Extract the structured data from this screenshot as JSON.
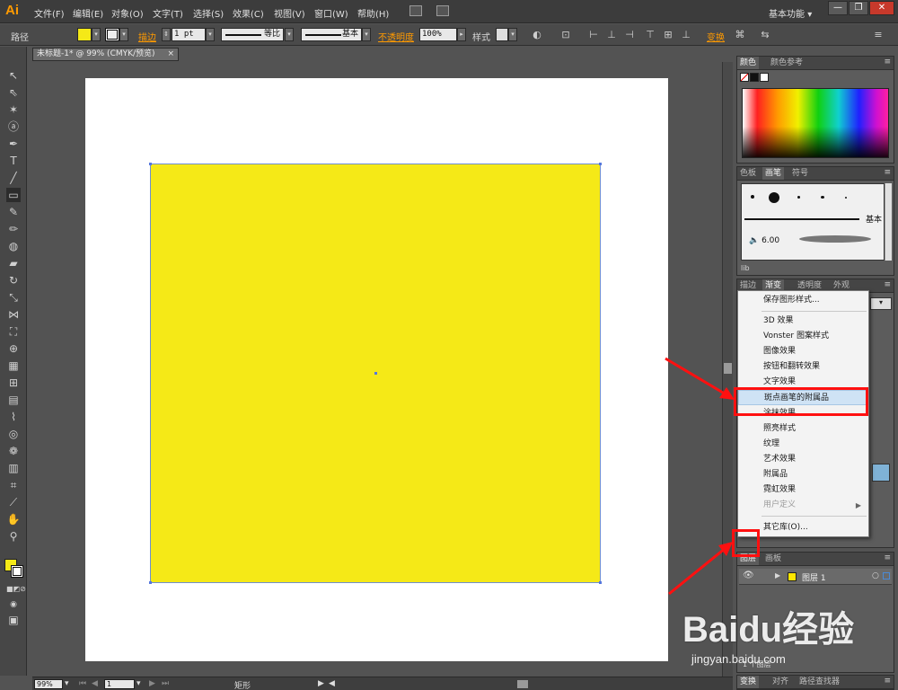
{
  "app": {
    "logo": "Ai",
    "workspace": "基本功能",
    "workspace_arrow": "▾"
  },
  "menu": [
    "文件(F)",
    "编辑(E)",
    "对象(O)",
    "文字(T)",
    "选择(S)",
    "效果(C)",
    "视图(V)",
    "窗口(W)",
    "帮助(H)"
  ],
  "window_buttons": {
    "minimize": "—",
    "restore": "❐",
    "close": "✕"
  },
  "control": {
    "object_type": "路径",
    "stroke_label": "描边",
    "stroke_weight": "1 pt",
    "profile_label": "等比",
    "brush_label": "基本",
    "opacity_label": "不透明度",
    "opacity_value": "100%",
    "style_label": "样式",
    "transform_label": "变换",
    "fill_color": "#f5e917"
  },
  "document": {
    "tab_title": "未标题-1* @ 99% (CMYK/预览)",
    "tab_close": "×",
    "rect_color": "#f5e917"
  },
  "status": {
    "zoom": "99%",
    "page": "1",
    "tool_name": "矩形"
  },
  "color_panel": {
    "tabs": [
      "颜色",
      "颜色参考"
    ]
  },
  "brush_panel": {
    "tabs": [
      "色板",
      "画笔",
      "符号"
    ],
    "basic_label": "基本",
    "size_label": "6.00",
    "lib_button": "lib"
  },
  "appearance_panel": {
    "tabs": [
      "描边",
      "渐变",
      "透明度",
      "外观"
    ]
  },
  "dropdown": {
    "items": [
      {
        "label": "保存图形样式..."
      },
      {
        "label": "3D 效果"
      },
      {
        "label": "Vonster 图案样式"
      },
      {
        "label": "图像效果"
      },
      {
        "label": "按钮和翻转效果"
      },
      {
        "label": "文字效果"
      },
      {
        "label": "斑点画笔的附属品"
      },
      {
        "label": "涂抹效果"
      },
      {
        "label": "照亮样式"
      },
      {
        "label": "纹理"
      },
      {
        "label": "艺术效果"
      },
      {
        "label": "附属品"
      },
      {
        "label": "霓虹效果"
      },
      {
        "label": "用户定义"
      },
      {
        "label": "其它库(O)..."
      }
    ],
    "highlighted": "斑点画笔的附属品"
  },
  "layers_panel": {
    "tabs": [
      "图层",
      "画板"
    ],
    "layer_name": "图层 1",
    "layer_color": "#ffe600",
    "footer": "1 个图层"
  },
  "bottom_panel": {
    "tabs": [
      "变换",
      "对齐",
      "路径查找器"
    ]
  },
  "watermark": {
    "main": "Baidu经验",
    "sub": "jingyan.baidu.com"
  },
  "annotation_color": "#ff1010"
}
